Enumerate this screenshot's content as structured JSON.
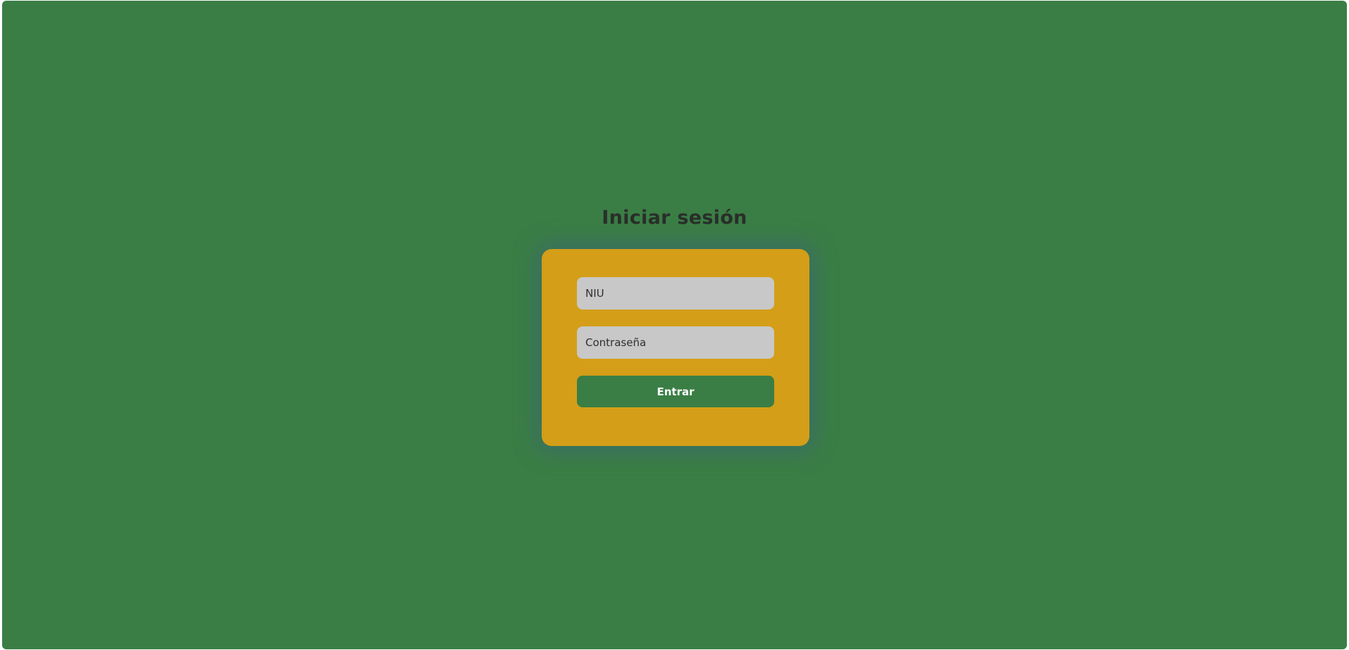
{
  "page": {
    "title": "Iniciar sesión"
  },
  "form": {
    "niu_placeholder": "NIU",
    "password_placeholder": "Contraseña",
    "submit_label": "Entrar"
  },
  "colors": {
    "background": "#3a7e45",
    "card": "#d49e18",
    "input": "#c8c8c8",
    "button": "#3a7e45",
    "title_text": "#2a2e2a"
  }
}
